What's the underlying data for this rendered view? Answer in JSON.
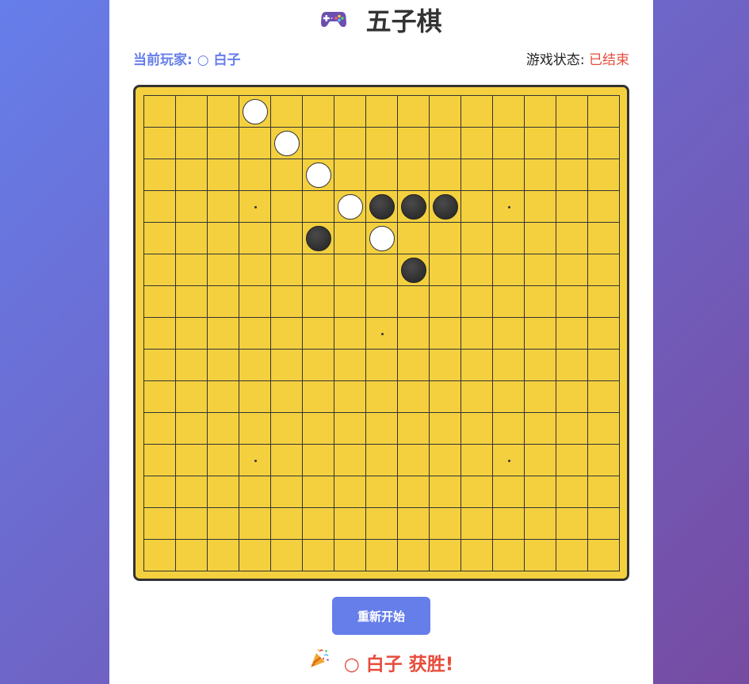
{
  "title": "五子棋",
  "title_icon": "gamepad-icon",
  "status": {
    "current_player_label": "当前玩家:",
    "current_player_value": "○ 白子",
    "game_state_label": "游戏状态:",
    "game_state_value": "已结束"
  },
  "board": {
    "size": 15,
    "star_points": [
      [
        3,
        3
      ],
      [
        3,
        11
      ],
      [
        7,
        7
      ],
      [
        11,
        3
      ],
      [
        11,
        11
      ]
    ],
    "stones": [
      {
        "row": 0,
        "col": 3,
        "color": "white"
      },
      {
        "row": 1,
        "col": 4,
        "color": "white"
      },
      {
        "row": 2,
        "col": 5,
        "color": "white"
      },
      {
        "row": 3,
        "col": 6,
        "color": "white"
      },
      {
        "row": 3,
        "col": 7,
        "color": "black"
      },
      {
        "row": 3,
        "col": 8,
        "color": "black"
      },
      {
        "row": 3,
        "col": 9,
        "color": "black"
      },
      {
        "row": 4,
        "col": 5,
        "color": "black"
      },
      {
        "row": 4,
        "col": 7,
        "color": "white"
      },
      {
        "row": 5,
        "col": 8,
        "color": "black"
      }
    ]
  },
  "restart_label": "重新开始",
  "result": {
    "icon": "party-popper-icon",
    "text": "○ 白子 获胜!"
  },
  "colors": {
    "accent": "#667eea",
    "board": "#f4d03f",
    "win": "#e74c3c"
  }
}
